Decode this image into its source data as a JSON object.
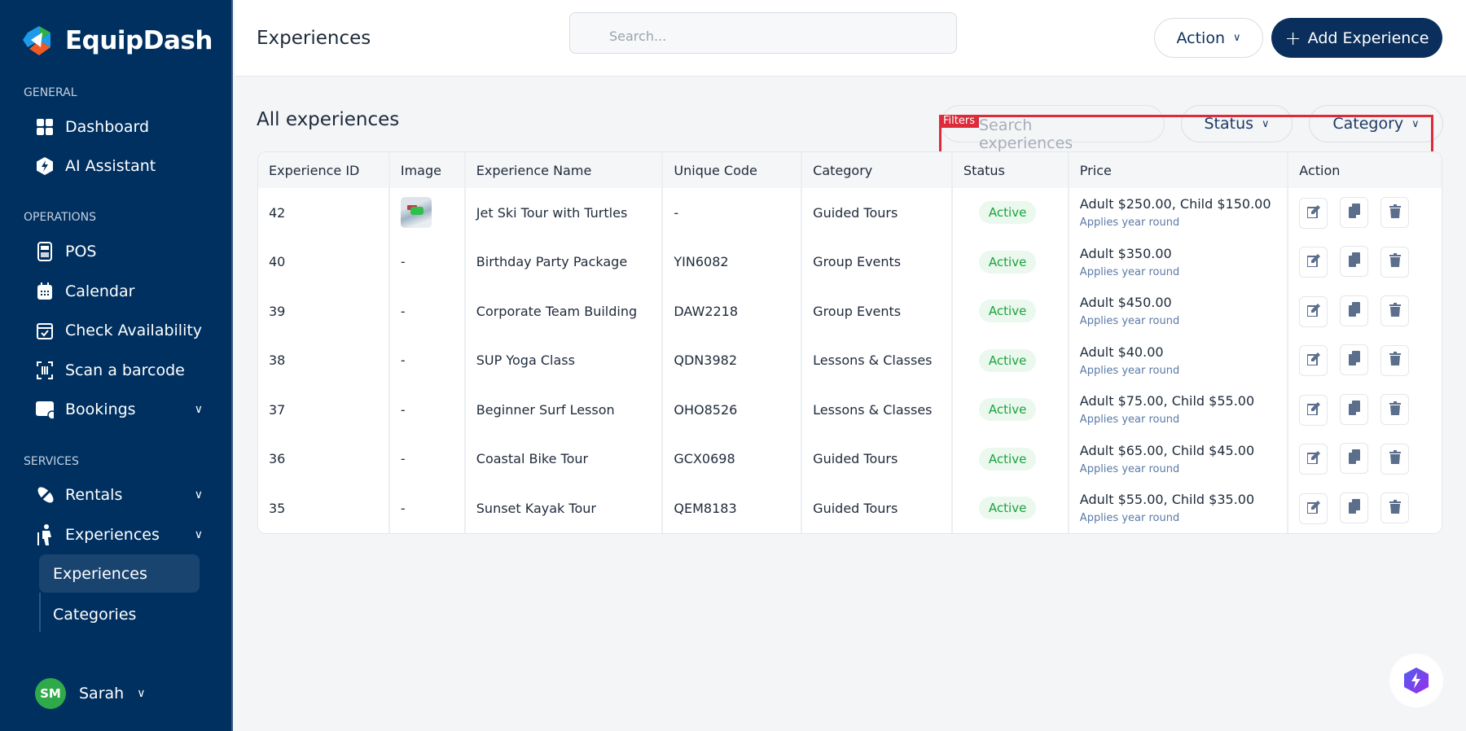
{
  "brand": {
    "name": "EquipDash"
  },
  "sidebar": {
    "sections": [
      "GENERAL",
      "OPERATIONS",
      "SERVICES"
    ],
    "items": [
      {
        "label": "Dashboard",
        "icon": "grid-icon"
      },
      {
        "label": "AI Assistant",
        "icon": "ai-bolt-icon"
      },
      {
        "label": "POS",
        "icon": "pos-terminal-icon"
      },
      {
        "label": "Calendar",
        "icon": "calendar-icon"
      },
      {
        "label": "Check Availability",
        "icon": "calendar-check-icon"
      },
      {
        "label": "Scan a barcode",
        "icon": "barcode-scan-icon"
      },
      {
        "label": "Bookings",
        "icon": "bookings-icon"
      },
      {
        "label": "Rentals",
        "icon": "kayak-icon"
      },
      {
        "label": "Experiences",
        "icon": "hiker-icon"
      }
    ],
    "subitems": [
      {
        "label": "Experiences",
        "active": true
      },
      {
        "label": "Categories",
        "active": false
      }
    ],
    "user": {
      "initials": "SM",
      "name": "Sarah",
      "avatar_color": "#2eaa4a"
    }
  },
  "header": {
    "title": "Experiences",
    "search_placeholder": "Search...",
    "action_label": "Action",
    "add_label": "Add Experience"
  },
  "main": {
    "title": "All experiences",
    "filters": {
      "annotation": "Filters",
      "search_placeholder": "Search experiences",
      "status_label": "Status",
      "category_label": "Category"
    },
    "columns": [
      "Experience ID",
      "Image",
      "Experience Name",
      "Unique Code",
      "Category",
      "Status",
      "Price",
      "Action"
    ],
    "rows": [
      {
        "id": "42",
        "image": true,
        "name": "Jet Ski Tour with Turtles",
        "code": "-",
        "category": "Guided Tours",
        "status": "Active",
        "price": "Adult $250.00, Child $150.00",
        "note": "Applies year round"
      },
      {
        "id": "40",
        "image": "-",
        "name": "Birthday Party Package",
        "code": "YIN6082",
        "category": "Group Events",
        "status": "Active",
        "price": "Adult $350.00",
        "note": "Applies year round"
      },
      {
        "id": "39",
        "image": "-",
        "name": "Corporate Team Building",
        "code": "DAW2218",
        "category": "Group Events",
        "status": "Active",
        "price": "Adult $450.00",
        "note": "Applies year round"
      },
      {
        "id": "38",
        "image": "-",
        "name": "SUP Yoga Class",
        "code": "QDN3982",
        "category": "Lessons & Classes",
        "status": "Active",
        "price": "Adult $40.00",
        "note": "Applies year round"
      },
      {
        "id": "37",
        "image": "-",
        "name": "Beginner Surf Lesson",
        "code": "OHO8526",
        "category": "Lessons & Classes",
        "status": "Active",
        "price": "Adult $75.00, Child $55.00",
        "note": "Applies year round"
      },
      {
        "id": "36",
        "image": "-",
        "name": "Coastal Bike Tour",
        "code": "GCX0698",
        "category": "Guided Tours",
        "status": "Active",
        "price": "Adult $65.00, Child $45.00",
        "note": "Applies year round"
      },
      {
        "id": "35",
        "image": "-",
        "name": "Sunset Kayak Tour",
        "code": "QEM8183",
        "category": "Guided Tours",
        "status": "Active",
        "price": "Adult $55.00, Child $35.00",
        "note": "Applies year round"
      }
    ]
  },
  "colors": {
    "sidebar": "#003060",
    "primary": "#0b2f5c",
    "active_badge": "#1aa33a",
    "highlight": "#dc2b3a"
  }
}
